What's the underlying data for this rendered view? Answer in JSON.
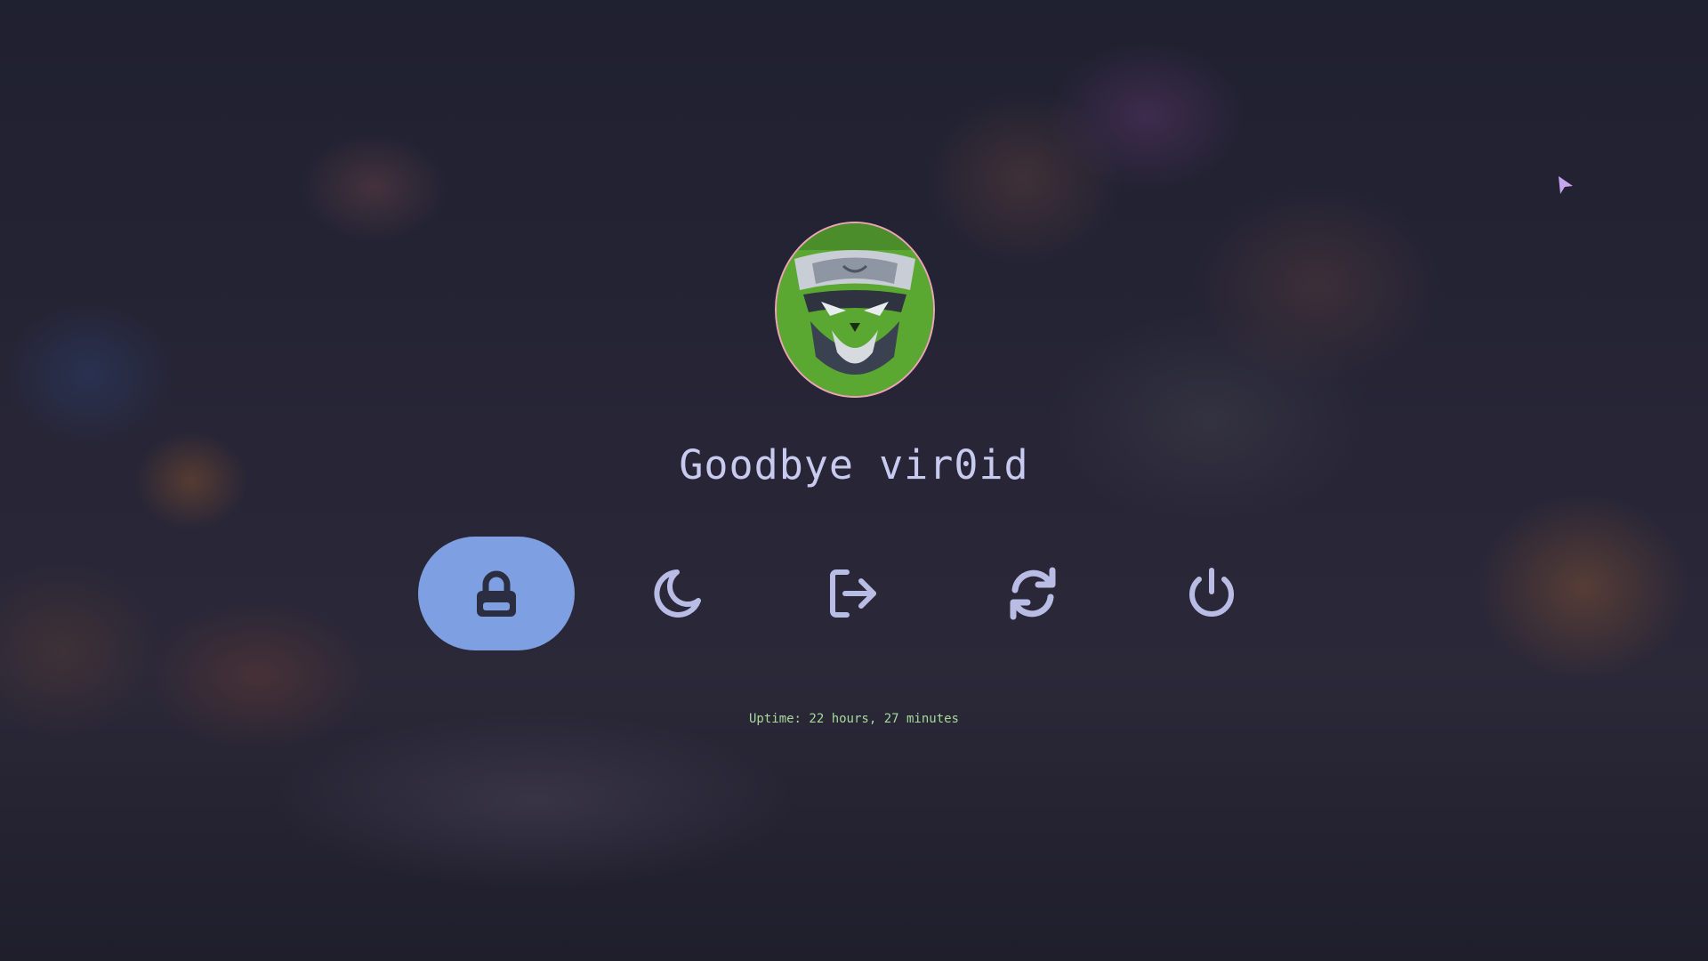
{
  "colors": {
    "accent": "#7f9fe3",
    "icon": "#b9bde6",
    "icon_active": "#2b2d40",
    "text": "#c8cbef",
    "uptime": "#a6d99b",
    "avatar_border": "#f0a3b8"
  },
  "user": {
    "greeting": "Goodbye vir0id",
    "avatar_icon": "user-avatar"
  },
  "actions": [
    {
      "name": "lock",
      "icon": "lock-icon",
      "active": true
    },
    {
      "name": "suspend",
      "icon": "moon-icon",
      "active": false
    },
    {
      "name": "logout",
      "icon": "logout-icon",
      "active": false
    },
    {
      "name": "reboot",
      "icon": "refresh-icon",
      "active": false
    },
    {
      "name": "shutdown",
      "icon": "power-icon",
      "active": false
    }
  ],
  "status": {
    "uptime": "Uptime: 22 hours, 27 minutes"
  }
}
